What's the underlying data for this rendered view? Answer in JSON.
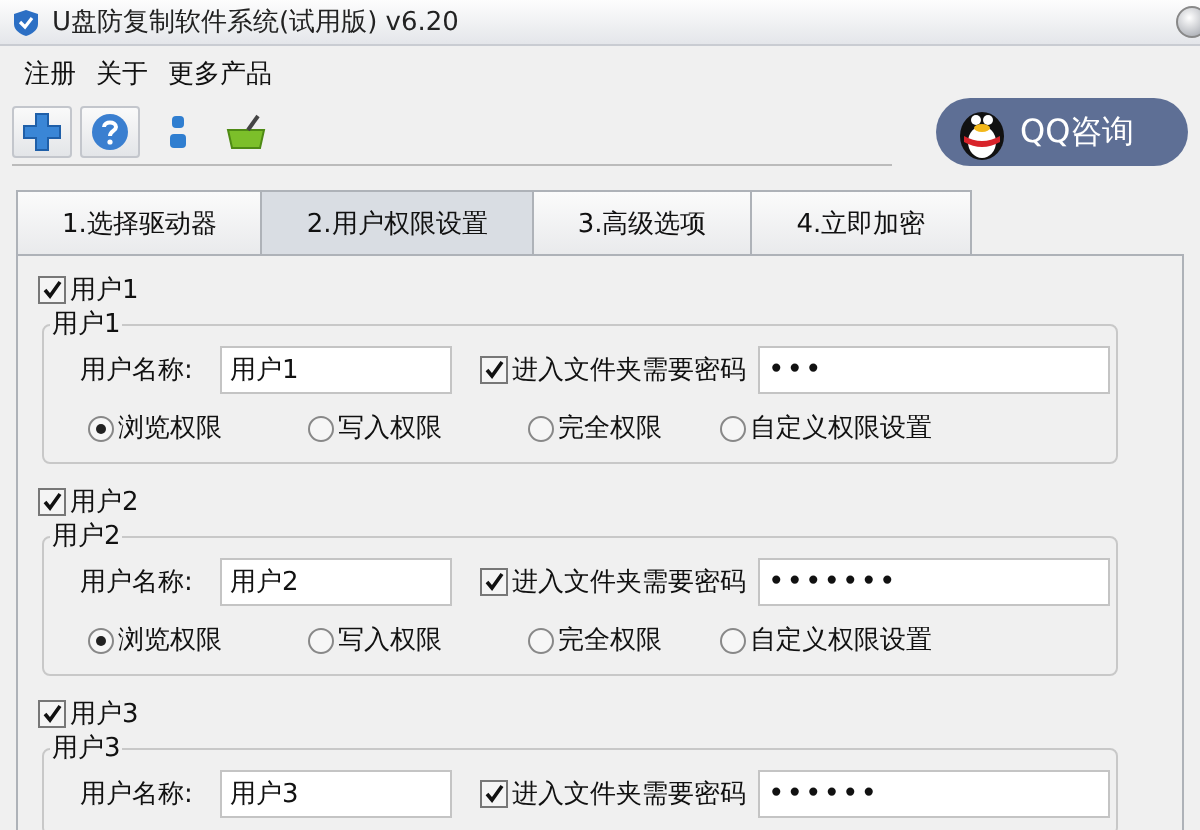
{
  "window": {
    "title": "U盘防复制软件系统(试用版) v6.20"
  },
  "menu": [
    "注册",
    "关于",
    "更多产品"
  ],
  "qq_button": {
    "label": "QQ咨询"
  },
  "tabs": [
    {
      "label": "1.选择驱动器",
      "selected": false
    },
    {
      "label": "2.用户权限设置",
      "selected": true
    },
    {
      "label": "3.高级选项",
      "selected": false
    },
    {
      "label": "4.立即加密",
      "selected": false
    }
  ],
  "users": [
    {
      "enabled": true,
      "title": "用户1",
      "legend": "用户1",
      "name_label": "用户名称:",
      "name_value": "用户1",
      "password_check": {
        "label": "进入文件夹需要密码",
        "checked": true
      },
      "password_value": "•••",
      "permissions": [
        {
          "label": "浏览权限",
          "selected": true
        },
        {
          "label": "写入权限",
          "selected": false
        },
        {
          "label": "完全权限",
          "selected": false
        },
        {
          "label": "自定义权限设置",
          "selected": false
        }
      ]
    },
    {
      "enabled": true,
      "title": "用户2",
      "legend": "用户2",
      "name_label": "用户名称:",
      "name_value": "用户2",
      "password_check": {
        "label": "进入文件夹需要密码",
        "checked": true
      },
      "password_value": "•••••••",
      "permissions": [
        {
          "label": "浏览权限",
          "selected": true
        },
        {
          "label": "写入权限",
          "selected": false
        },
        {
          "label": "完全权限",
          "selected": false
        },
        {
          "label": "自定义权限设置",
          "selected": false
        }
      ]
    },
    {
      "enabled": true,
      "title": "用户3",
      "legend": "用户3",
      "name_label": "用户名称:",
      "name_value": "用户3",
      "password_check": {
        "label": "进入文件夹需要密码",
        "checked": true
      },
      "password_value": "••••••"
    }
  ]
}
